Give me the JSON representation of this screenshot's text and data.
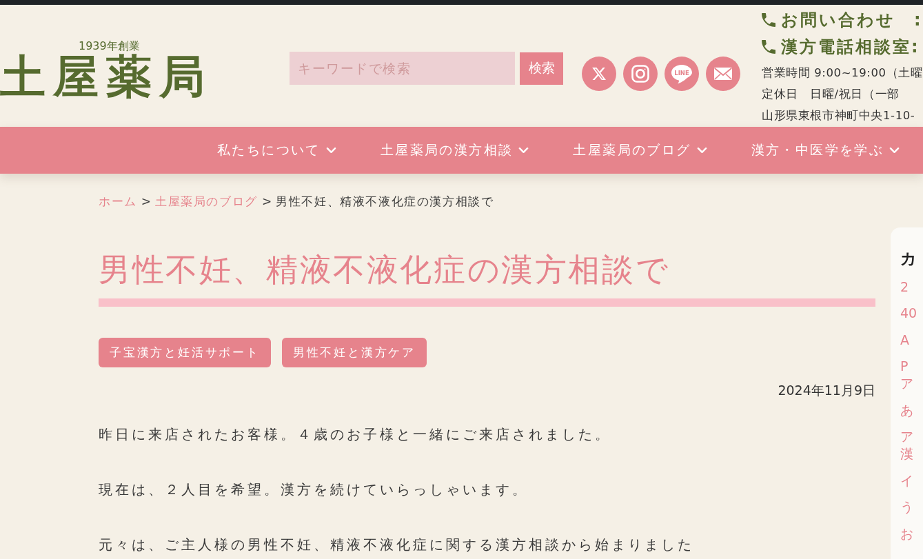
{
  "header": {
    "logo": {
      "tagline": "1939年創業",
      "name": "土屋薬局"
    },
    "search": {
      "placeholder": "キーワードで検索",
      "button": "検索"
    },
    "social_links": [
      {
        "kind": "x"
      },
      {
        "kind": "instagram"
      },
      {
        "kind": "line",
        "label": "LINE"
      },
      {
        "kind": "mail"
      }
    ],
    "contact": {
      "phone_lines": [
        "お問い合わせ　:",
        "漢方電話相談室:"
      ],
      "info_lines": [
        "営業時間 9:00~19:00（土曜",
        "定休日　日曜/祝日（一部",
        "山形県東根市神町中央1-10-"
      ]
    }
  },
  "nav": [
    {
      "label": "私たちについて",
      "has_dropdown": true
    },
    {
      "label": "土屋薬局の漢方相談",
      "has_dropdown": true
    },
    {
      "label": "土屋薬局のブログ",
      "has_dropdown": true
    },
    {
      "label": "漢方・中医学を学ぶ",
      "has_dropdown": true
    }
  ],
  "breadcrumb": [
    {
      "kind": "link",
      "label": "ホーム"
    },
    {
      "kind": "separator",
      "label": ">"
    },
    {
      "kind": "link",
      "label": "土屋薬局のブログ"
    },
    {
      "kind": "separator",
      "label": ">"
    },
    {
      "kind": "current",
      "label": "男性不妊、精液不液化症の漢方相談で"
    }
  ],
  "article": {
    "title": "男性不妊、精液不液化症の漢方相談で",
    "tags": [
      "子宝漢方と妊活サポート",
      "男性不妊と漢方ケア"
    ],
    "date": "2024年11月9日",
    "paragraphs": [
      "昨日に来店されたお客様。４歳のお子様と一緒にご来店されました。",
      "現在は、２人目を希望。漢方を続けていらっしゃいます。",
      "元々は、ご主人様の男性不妊、精液不液化症に関する漢方相談から始まりました"
    ]
  },
  "sidebar": {
    "heading": "カ",
    "items": [
      "2",
      "40",
      "A",
      "Pア",
      "あ",
      "ア漢",
      "イ",
      "う",
      "お"
    ]
  }
}
